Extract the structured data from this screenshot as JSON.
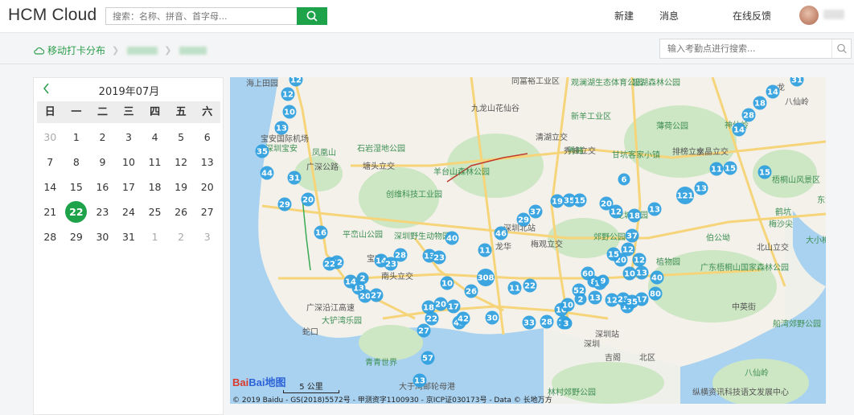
{
  "header": {
    "brand": "HCM Cloud",
    "search_placeholder": "搜索：名称、拼音、首字母...",
    "search_button_icon": "search-icon",
    "nav": [
      "新建",
      "消息",
      "在线反馈"
    ]
  },
  "subheader": {
    "breadcrumb_icon": "cloud-icon",
    "breadcrumb_title": "移动打卡分布",
    "search_placeholder": "输入考勤点进行搜索...",
    "search_icon": "search-icon"
  },
  "calendar": {
    "prev_icon": "chevron-left-icon",
    "title": "2019年07月",
    "weekdays": [
      "日",
      "一",
      "二",
      "三",
      "四",
      "五",
      "六"
    ],
    "days": [
      "30",
      "1",
      "2",
      "3",
      "4",
      "5",
      "6",
      "7",
      "8",
      "9",
      "10",
      "11",
      "12",
      "13",
      "14",
      "15",
      "16",
      "17",
      "18",
      "19",
      "20",
      "21",
      "22",
      "23",
      "24",
      "25",
      "26",
      "27",
      "28",
      "29",
      "30",
      "31",
      "1",
      "2",
      "3"
    ],
    "muted_days": [
      0,
      32,
      33,
      34
    ],
    "selected_day": "22",
    "accent_color": "#1fa34a"
  },
  "map": {
    "markers": [
      "12",
      "12",
      "10",
      "13",
      "35",
      "44",
      "31",
      "29",
      "20",
      "16",
      "32",
      "22",
      "13",
      "14",
      "2",
      "20",
      "27",
      "14",
      "23",
      "28",
      "13",
      "23",
      "40",
      "46",
      "11",
      "308",
      "37",
      "29",
      "19",
      "35",
      "15",
      "20",
      "12",
      "18",
      "13",
      "121",
      "13",
      "15",
      "31",
      "14",
      "18",
      "28",
      "14",
      "15",
      "11",
      "10",
      "26",
      "42",
      "30",
      "57",
      "13",
      "27",
      "22",
      "18",
      "20",
      "17",
      "42",
      "33",
      "28",
      "13",
      "80",
      "40",
      "17",
      "12",
      "13",
      "10",
      "52",
      "60",
      "8",
      "19",
      "9",
      "12",
      "17",
      "23",
      "35",
      "13",
      "2",
      "10",
      "10",
      "3",
      "37",
      "12",
      "20",
      "15",
      "22",
      "11",
      "6"
    ],
    "labels": [
      "海上田园",
      "宝安国际机场",
      "深圳宝安",
      "凤凰山",
      "石岩湿地公园",
      "塘头立交",
      "羊台山森林公园",
      "清湖立交",
      "秀峰立交",
      "秀峰",
      "甘坑客家小镇",
      "排榜立交",
      "水晶立交",
      "神仙岭",
      "龙",
      "八仙岭",
      "九龙山花仙谷",
      "同富裕工业区",
      "观澜湖生态体育公园",
      "碧湖森林公园",
      "新羊工业区",
      "薄荷公园",
      "创维科技工业园",
      "深圳野生动物园",
      "平峦山公园",
      "宝安",
      "南头立交",
      "深圳北站",
      "梅观立交",
      "龙华",
      "龙城公园",
      "郊野公园",
      "植物园",
      "北山立交",
      "广东梧桐山国家森林公园",
      "大铲湾乐园",
      "青青世界",
      "大小梅沙",
      "深圳站",
      "吉阁",
      "北区",
      "中英街",
      "船湾郊野公园",
      "八仙岭",
      "大于湾邮轮母港",
      "林村郊野公园",
      "纵横资讯科技语文发展中心",
      "梧桐山风景区",
      "东涌",
      "鹤坑",
      "梅沙尖",
      "伯公坳",
      "深圳",
      "蛇口",
      "广深沿江高速",
      "广深公路"
    ],
    "logo_text": "Bai地图",
    "scale_text": "5 公里",
    "copyright": "© 2019 Baidu - GS(2018)5572号 - 甲测资字1100930 - 京ICP证030173号 - Data © 长地万方"
  },
  "colors": {
    "green": "#1fa34a",
    "marker": "#2ea0e0",
    "road": "#f6d47a"
  }
}
